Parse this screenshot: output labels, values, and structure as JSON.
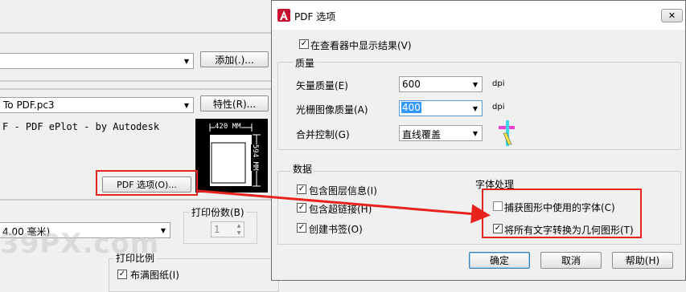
{
  "bg": {
    "add_button": "添加(.)...",
    "plotter_value": "To PDF.pc3",
    "properties_button": "特性(R)...",
    "description": "F - PDF ePlot - by Autodesk",
    "preview_width": "420 MM",
    "preview_height": "594 MM",
    "pdf_options_button": "PDF 选项(O)...",
    "paper_size_value": "4.00 毫米)",
    "copies_label": "打印份数(B)",
    "copies_value": "1",
    "scale_label": "打印比例",
    "fit_paper_label": "布满图纸(I)",
    "watermark": "39PX.com"
  },
  "pdf": {
    "title": "PDF 选项",
    "close_icon": "close-icon",
    "show_in_viewer": "在查看器中显示结果(V)",
    "quality_group": "质量",
    "vector_label": "矢量质量(E)",
    "vector_value": "600",
    "raster_label": "光栅图像质量(A)",
    "raster_value": "400",
    "merge_label": "合并控制(G)",
    "merge_value": "直线覆盖",
    "dpi1": "dpi",
    "dpi2": "dpi",
    "data_group": "数据",
    "include_layers": "包含图层信息(I)",
    "include_hyperlinks": "包含超链接(H)",
    "create_bookmarks": "创建书签(O)",
    "font_group": "字体处理",
    "capture_fonts": "捕获图形中使用的字体(C)",
    "convert_text": "将所有文字转换为几何图形(T)",
    "ok_button": "确定",
    "cancel_button": "取消",
    "help_button": "帮助(H)"
  },
  "checks": {
    "show_in_viewer": true,
    "include_layers": true,
    "include_hyperlinks": true,
    "create_bookmarks": true,
    "capture_fonts": false,
    "convert_text": true,
    "fit_paper": true
  },
  "colors": {
    "highlight_red": "#e8231c",
    "selection_blue": "#3399ff"
  }
}
